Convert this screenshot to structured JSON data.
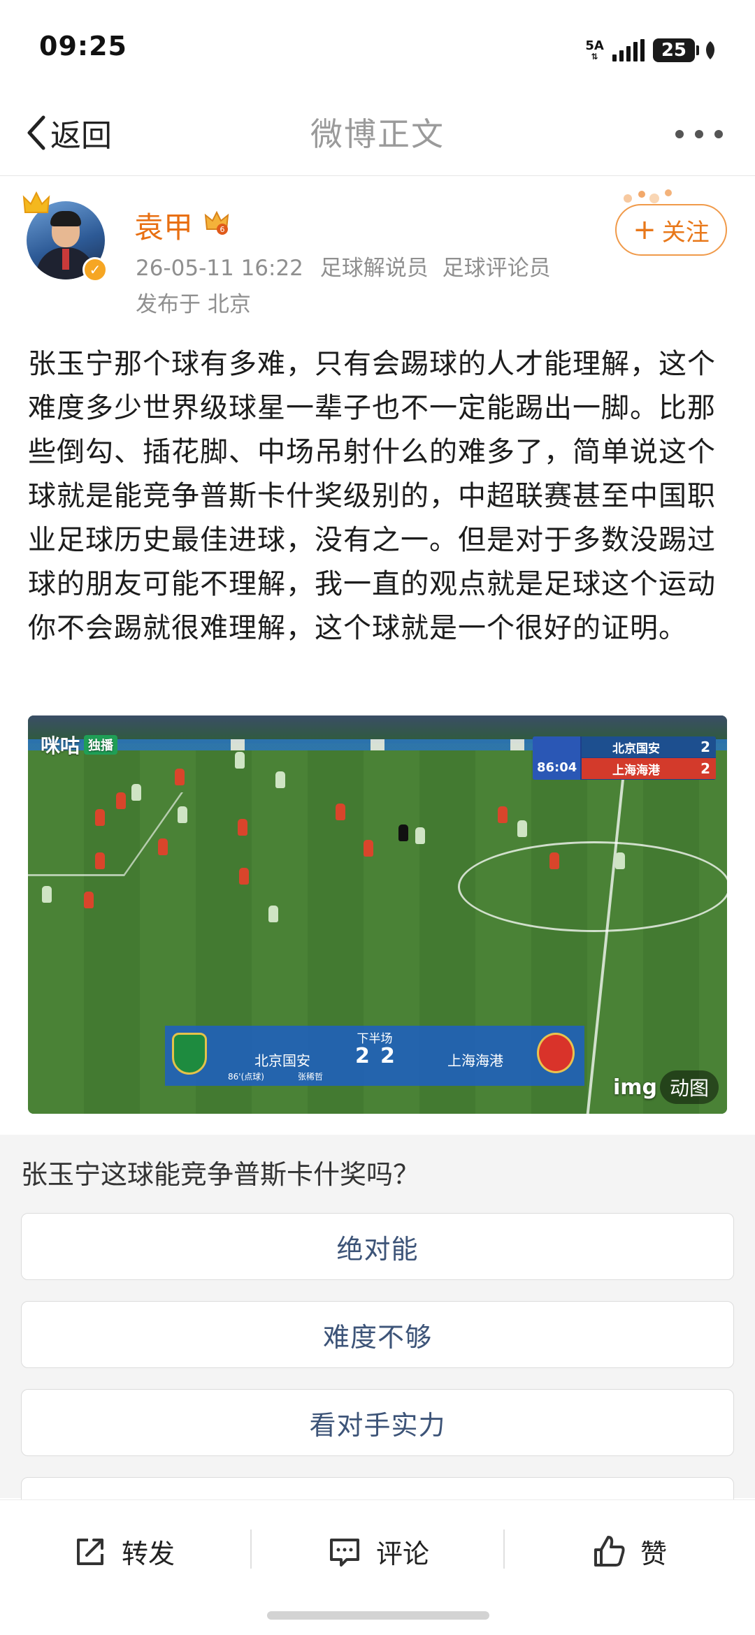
{
  "status": {
    "time": "09:25",
    "network": "5A",
    "battery": "25"
  },
  "nav": {
    "back_label": "返回",
    "title": "微博正文"
  },
  "author": {
    "name": "袁甲",
    "datetime": "26-05-11 16:22",
    "tags": [
      "足球解说员",
      "足球评论员"
    ],
    "location": "发布于 北京",
    "follow_label": "关注",
    "accent_color": "#e86f12"
  },
  "post": {
    "text": "张玉宁那个球有多难，只有会踢球的人才能理解，这个难度多少世界级球星一辈子也不一定能踢出一脚。比那些倒勾、插花脚、中场吊射什么的难多了，简单说这个球就是能竞争普斯卡什奖级别的，中超联赛甚至中国职业足球历史最佳进球，没有之一。但是对于多数没踢过球的朋友可能不理解，我一直的观点就是足球这个运动你不会踢就很难理解，这个球就是一个很好的证明。"
  },
  "media": {
    "watermark": "咪咕",
    "watermark_tag": "独播",
    "gif_brand": "img",
    "gif_badge": "动图",
    "scoreboard_top": {
      "clock": "86:04",
      "home": "北京国安",
      "home_score": "2",
      "away": "上海海港",
      "away_score": "2"
    },
    "scoreboard_bottom": {
      "period": "下半场",
      "home": "北京国安",
      "home_score": "2",
      "away_score": "2",
      "away": "上海海港",
      "scorer_minute": "86'(点球)",
      "scorer": "张稀哲"
    }
  },
  "poll": {
    "question": "张玉宁这球能竞争普斯卡什奖吗？",
    "options": [
      "绝对能",
      "难度不够",
      "看对手实力"
    ]
  },
  "bottom_bar": {
    "repost_label": "转发",
    "comment_label": "评论",
    "like_label": "赞"
  }
}
